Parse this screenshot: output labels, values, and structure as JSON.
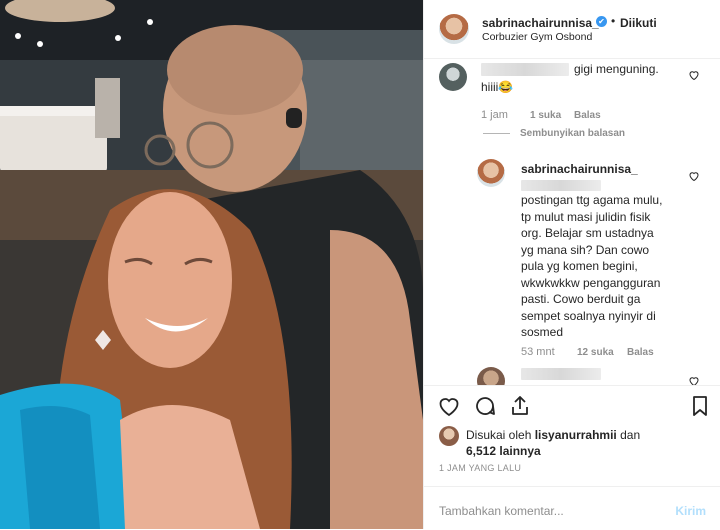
{
  "header": {
    "username": "sabrinachairunnisa_",
    "verified_mark": "✔",
    "separator": "•",
    "follow_label": "Diikuti",
    "location": "Corbuzier Gym Osbond"
  },
  "comments": {
    "first": {
      "text_line1": "gigi menguning.",
      "text_line2": "hiiii😂",
      "time": "1 jam",
      "likes": "1 suka",
      "reply": "Balas",
      "hide_replies": "Sembunyikan balasan"
    },
    "reply": {
      "username": "sabrinachairunnisa_",
      "lines": [
        "postingan ttg agama mulu,",
        "tp mulut masi julidin fisik",
        "org. Belajar sm ustadnya",
        "yg mana sih? Dan cowo",
        "pula yg komen begini,",
        "wkwkwkkw pengangguran",
        "pasti. Cowo berduit ga",
        "sempet soalnya nyinyir di",
        "sosmed"
      ],
      "time": "53 mnt",
      "likes": "12 suka",
      "reply": "Balas"
    }
  },
  "likes": {
    "line1_prefix": "Disukai oleh",
    "liker": "lisyanurrahmii",
    "line1_suffix": "dan",
    "count": "6,512 lainnya"
  },
  "timestamp": "1 JAM YANG LALU",
  "add_comment": {
    "placeholder": "Tambahkan komentar...",
    "post_label": "Kirim"
  },
  "icons": [
    "heart-icon",
    "comment-icon",
    "share-icon",
    "bookmark-icon"
  ]
}
